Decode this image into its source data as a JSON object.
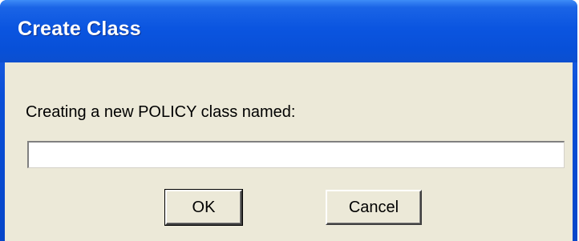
{
  "window": {
    "title": "Create Class"
  },
  "dialog": {
    "prompt": "Creating a new POLICY class named:",
    "name_input_value": "",
    "ok_label": "OK",
    "cancel_label": "Cancel"
  },
  "colors": {
    "titlebar": "#0b55e0",
    "client_background": "#ece9d8"
  }
}
